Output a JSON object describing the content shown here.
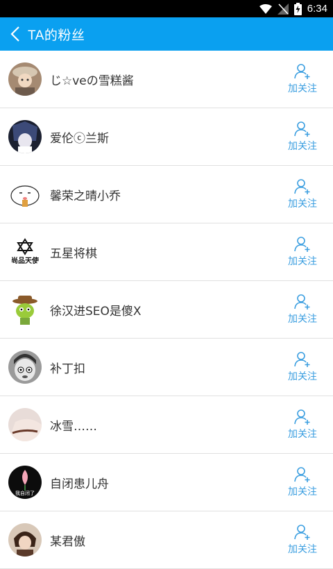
{
  "status_bar": {
    "time": "6:34"
  },
  "header": {
    "title": "TA的粉丝"
  },
  "follow_label": "加关注",
  "users": [
    {
      "name": "じ☆veの雪糕酱",
      "avatar": "girl-hat-avatar"
    },
    {
      "name": "爱伦ⓒ兰斯",
      "avatar": "anime-boy-avatar"
    },
    {
      "name": "馨荣之晴小乔",
      "avatar": "cartoon-face-avatar"
    },
    {
      "name": "五星将棋",
      "avatar": "logo-avatar"
    },
    {
      "name": "徐汉进SEO是傻X",
      "avatar": "cartoon-cowboy-avatar"
    },
    {
      "name": "补丁扣",
      "avatar": "crying-face-avatar"
    },
    {
      "name": "冰雪……",
      "avatar": "hand-bracelet-avatar"
    },
    {
      "name": "自闭患儿舟",
      "avatar": "lotus-avatar"
    },
    {
      "name": "某君傲",
      "avatar": "anime-character-avatar"
    }
  ],
  "logo_avatar_text": "尚品天使",
  "lotus_avatar_text": "我自闭了",
  "colors": {
    "accent": "#0aa0f0",
    "follow": "#3a9ee0"
  }
}
